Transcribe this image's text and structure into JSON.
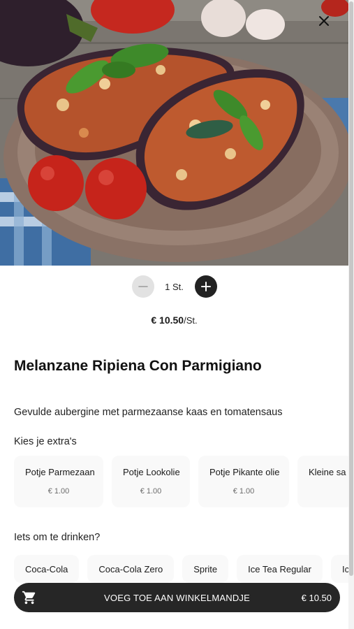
{
  "product": {
    "name": "Melanzane Ripiena Con Parmigiano",
    "description": "Gevulde aubergine met parmezaanse kaas en tomatensaus",
    "image_alt": "Melanzane Ripiena Con Parmigiano"
  },
  "quantity": {
    "value": "1 St."
  },
  "price": {
    "amount": "€ 10.50",
    "unit": "/St."
  },
  "extras": {
    "label": "Kies je extra's",
    "items": [
      {
        "name": "Potje Parmezaan",
        "price": "€ 1.00"
      },
      {
        "name": "Potje Lookolie",
        "price": "€ 1.00"
      },
      {
        "name": "Potje Pikante olie",
        "price": "€ 1.00"
      },
      {
        "name": "Kleine sa",
        "price": ""
      }
    ]
  },
  "drinks": {
    "label": "Iets om te drinken?",
    "items": [
      {
        "name": "Coca-Cola"
      },
      {
        "name": "Coca-Cola Zero"
      },
      {
        "name": "Sprite"
      },
      {
        "name": "Ice Tea Regular"
      },
      {
        "name": "Ic"
      }
    ]
  },
  "cart": {
    "label": "VOEG TOE AAN WINKELMANDJE",
    "total": "€ 10.50"
  },
  "colors": {
    "button_dark": "#262626",
    "card_bg": "#f9f9f9",
    "minus_bg": "#e2e2e2"
  },
  "icons": {
    "close": "close-icon",
    "minus": "minus-icon",
    "plus": "plus-icon",
    "cart": "cart-icon"
  }
}
